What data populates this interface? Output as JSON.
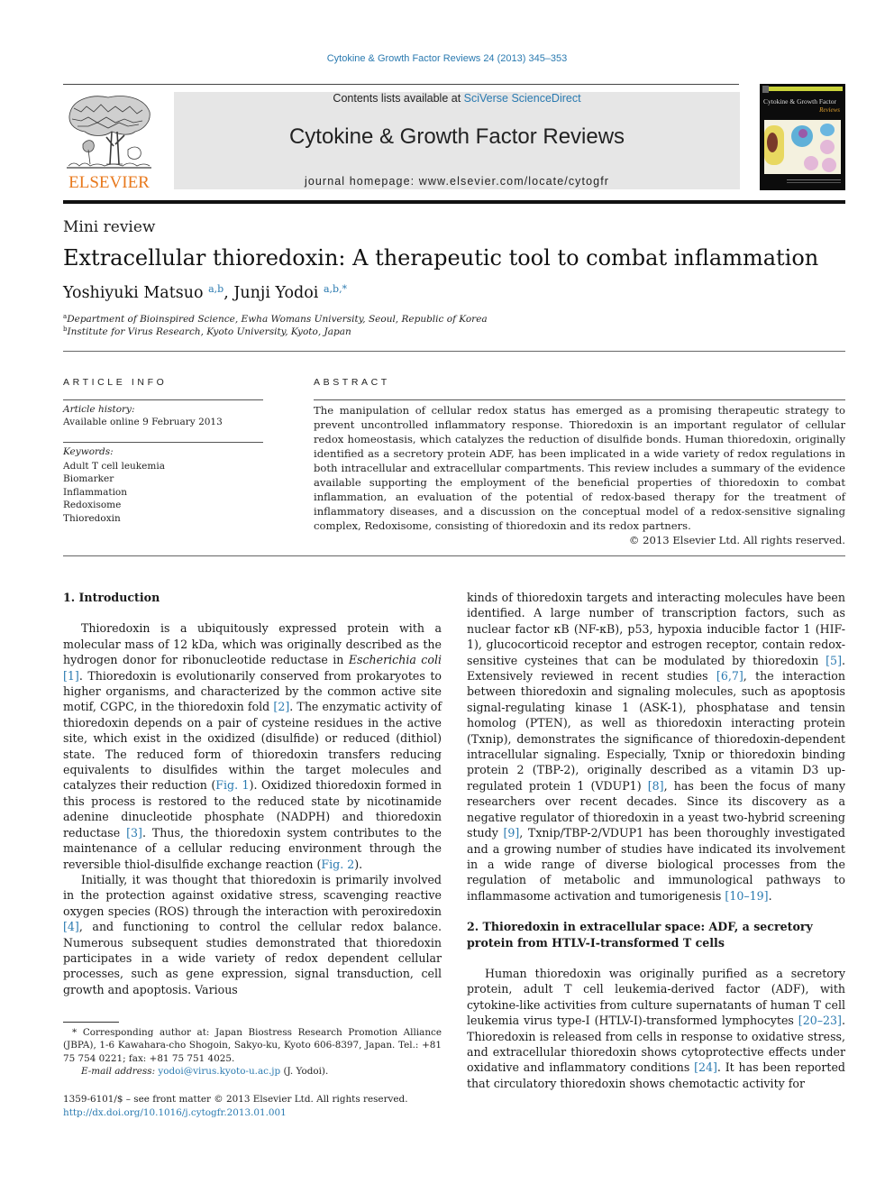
{
  "running_header": "Cytokine & Growth Factor Reviews 24 (2013) 345–353",
  "masthead": {
    "publisher_logo_text": "ELSEVIER",
    "contents_prefix": "Contents lists available at ",
    "contents_link": "SciVerse ScienceDirect",
    "journal_title": "Cytokine & Growth Factor Reviews",
    "homepage_prefix": "journal homepage: ",
    "homepage_url": "www.elsevier.com/locate/cytogfr",
    "cover": {
      "title": "Cytokine & Growth Factor",
      "subtitle": "Reviews"
    }
  },
  "article": {
    "type": "Mini review",
    "title": "Extracellular thioredoxin: A therapeutic tool to combat inflammation",
    "authors": [
      {
        "name": "Yoshiyuki Matsuo",
        "sup": "a,b"
      },
      {
        "name": "Junji Yodoi",
        "sup": "a,b,*"
      }
    ],
    "author_separator": ", ",
    "affiliations": [
      {
        "mark": "a",
        "text": "Department of Bioinspired Science, Ewha Womans University, Seoul, Republic of Korea"
      },
      {
        "mark": "b",
        "text": "Institute for Virus Research, Kyoto University, Kyoto, Japan"
      }
    ]
  },
  "article_info": {
    "heading": "ARTICLE INFO",
    "history_label": "Article history:",
    "history_value": "Available online 9 February 2013",
    "keywords_label": "Keywords:",
    "keywords": [
      "Adult T cell leukemia",
      "Biomarker",
      "Inflammation",
      "Redoxisome",
      "Thioredoxin"
    ]
  },
  "abstract": {
    "heading": "ABSTRACT",
    "text": "The manipulation of cellular redox status has emerged as a promising therapeutic strategy to prevent uncontrolled inflammatory response. Thioredoxin is an important regulator of cellular redox homeostasis, which catalyzes the reduction of disulfide bonds. Human thioredoxin, originally identified as a secretory protein ADF, has been implicated in a wide variety of redox regulations in both intracellular and extracellular compartments. This review includes a summary of the evidence available supporting the employment of the beneficial properties of thioredoxin to combat inflammation, an evaluation of the potential of redox-based therapy for the treatment of inflammatory diseases, and a discussion on the conceptual model of a redox-sensitive signaling complex, Redoxisome, consisting of thioredoxin and its redox partners.",
    "copyright": "© 2013 Elsevier Ltd. All rights reserved."
  },
  "body": {
    "section1": {
      "heading": "1.  Introduction",
      "p1": [
        {
          "t": "Thioredoxin is a ubiquitously expressed protein with a molecular mass of 12 kDa, which was originally described as the hydrogen donor for ribonucleotide reductase in "
        },
        {
          "t": "Escherichia coli",
          "style": "italic"
        },
        {
          "t": " "
        },
        {
          "t": "[1]",
          "style": "link"
        },
        {
          "t": ". Thioredoxin is evolutionarily conserved from prokaryotes to higher organisms, and characterized by the common active site motif, CGPC, in the thioredoxin fold "
        },
        {
          "t": "[2]",
          "style": "link"
        },
        {
          "t": ". The enzymatic activity of thioredoxin depends on a pair of cysteine residues in the active site, which exist in the oxidized (disulfide) or reduced (dithiol) state. The reduced form of thioredoxin transfers reducing equivalents to disulfides within the target molecules and catalyzes their reduction ("
        },
        {
          "t": "Fig. 1",
          "style": "link"
        },
        {
          "t": "). Oxidized thioredoxin formed in this process is restored to the reduced state by nicotinamide adenine dinucleotide phosphate (NADPH) and thioredoxin reductase "
        },
        {
          "t": "[3]",
          "style": "link"
        },
        {
          "t": ". Thus, the thioredoxin system contributes to the maintenance of a cellular reducing environment through the reversible thiol-disulfide exchange reaction ("
        },
        {
          "t": "Fig. 2",
          "style": "link"
        },
        {
          "t": ")."
        }
      ],
      "p2": [
        {
          "t": "Initially, it was thought that thioredoxin is primarily involved in the protection against oxidative stress, scavenging reactive oxygen species (ROS) through the interaction with peroxiredoxin "
        },
        {
          "t": "[4]",
          "style": "link"
        },
        {
          "t": ", and functioning to control the cellular redox balance. Numerous subsequent studies demonstrated that thioredoxin participates in a wide variety of redox dependent cellular processes, such as gene expression, signal transduction, cell growth and apoptosis. Various kinds of thioredoxin targets and interacting molecules have been identified. A large number of transcription factors, such as nuclear factor κB (NF-κB), p53, hypoxia inducible factor 1 (HIF-1), glucocorticoid receptor and estrogen receptor, contain redox-sensitive cysteines that can be modulated by thioredoxin "
        },
        {
          "t": "[5]",
          "style": "link"
        },
        {
          "t": ". Extensively reviewed in recent studies "
        },
        {
          "t": "[6,7]",
          "style": "link"
        },
        {
          "t": ", the interaction between thioredoxin and signaling molecules, such as apoptosis signal-regulating kinase 1 (ASK-1), phosphatase and tensin homolog (PTEN), as well as thioredoxin interacting protein (Txnip), demonstrates the significance of thioredoxin-dependent intracellular signaling. Especially, Txnip or thioredoxin binding protein 2 (TBP-2), originally described as a vitamin D3 up-regulated protein 1 (VDUP1) "
        },
        {
          "t": "[8]",
          "style": "link"
        },
        {
          "t": ", has been the focus of many researchers over recent decades. Since its discovery as a negative regulator of thioredoxin in a yeast two-hybrid screening study "
        },
        {
          "t": "[9]",
          "style": "link"
        },
        {
          "t": ", Txnip/TBP-2/VDUP1 has been thoroughly investigated and a growing number of studies have indicated its involvement in a wide range of diverse biological processes from the regulation of metabolic and immunological pathways to inflammasome activation and tumorigenesis "
        },
        {
          "t": "[10–19]",
          "style": "link"
        },
        {
          "t": "."
        }
      ]
    },
    "section2": {
      "heading": "2.  Thioredoxin in extracellular space: ADF, a secretory protein from HTLV-I-transformed T cells",
      "p1": [
        {
          "t": "Human thioredoxin was originally purified as a secretory protein, adult T cell leukemia-derived factor (ADF), with cytokine-like activities from culture supernatants of human T cell leukemia virus type-I (HTLV-I)-transformed lymphocytes "
        },
        {
          "t": "[20–23]",
          "style": "link"
        },
        {
          "t": ". Thioredoxin is released from cells in response to oxidative stress, and extracellular thioredoxin shows cytoprotective effects under oxidative and inflammatory conditions "
        },
        {
          "t": "[24]",
          "style": "link"
        },
        {
          "t": ". It has been reported that circulatory thioredoxin shows chemotactic activity for"
        }
      ]
    }
  },
  "footnote": {
    "mark": "*",
    "corresponding": "Corresponding author at: Japan Biostress Research Promotion Alliance (JBPA), 1-6 Kawahara-cho Shogoin, Sakyo-ku, Kyoto 606-8397, Japan. Tel.: +81 75 754 0221; fax: +81 75 751 4025.",
    "email_label": "E-mail address: ",
    "email": "yodoi@virus.kyoto-u.ac.jp",
    "email_suffix": " (J. Yodoi)."
  },
  "front_matter": {
    "issn_line": "1359-6101/$ – see front matter © 2013 Elsevier Ltd. All rights reserved.",
    "doi": "http://dx.doi.org/10.1016/j.cytogfr.2013.01.001"
  },
  "colors": {
    "link": "#2a7ab0",
    "elsevier_orange": "#e8791d",
    "masthead_gray": "#e6e6e6"
  }
}
